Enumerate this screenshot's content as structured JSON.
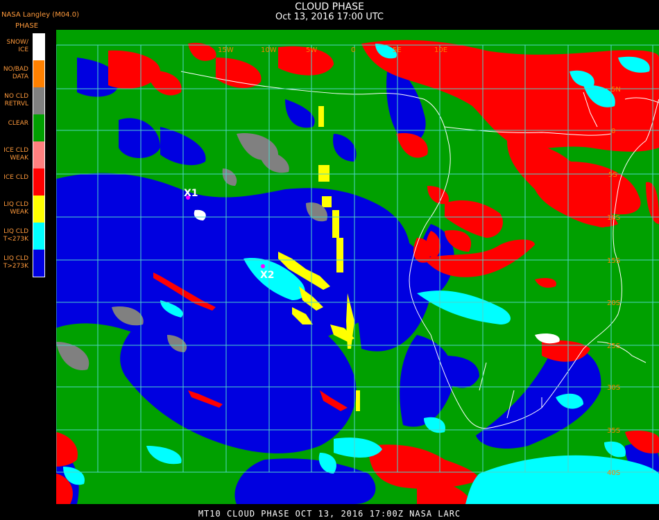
{
  "header": {
    "title": "CLOUD PHASE",
    "datetime": "Oct 13, 2016 17:00 UTC",
    "source": "NASA Langley (M04.0)",
    "legend_title": "PHASE"
  },
  "legend": [
    {
      "label": "SNOW/\nICE",
      "color": "#ffffff"
    },
    {
      "label": "NO/BAD\nDATA",
      "color": "#ff8000"
    },
    {
      "label": "NO CLD\nRETRVL",
      "color": "#808080"
    },
    {
      "label": "CLEAR",
      "color": "#00a000"
    },
    {
      "label": "ICE CLD\nWEAK",
      "color": "#ff8080"
    },
    {
      "label": "ICE CLD",
      "color": "#ff0000"
    },
    {
      "label": "LIQ CLD\nWEAK",
      "color": "#ffff00"
    },
    {
      "label": "LIQ CLD\nT<273K",
      "color": "#00ffff"
    },
    {
      "label": "LIQ CLD\nT>273K",
      "color": "#0000e0"
    }
  ],
  "markers": [
    {
      "label": "X1"
    },
    {
      "label": "X2"
    }
  ],
  "lat_labels": [
    "5N",
    "0",
    "5S",
    "10S",
    "15S",
    "20S",
    "25S",
    "30S",
    "35S",
    "40S"
  ],
  "lon_labels": [
    "15W",
    "10W",
    "5W",
    "0",
    "5E",
    "10E"
  ],
  "footer": "MT10  CLOUD PHASE   OCT 13, 2016 17:00Z  NASA LARC"
}
